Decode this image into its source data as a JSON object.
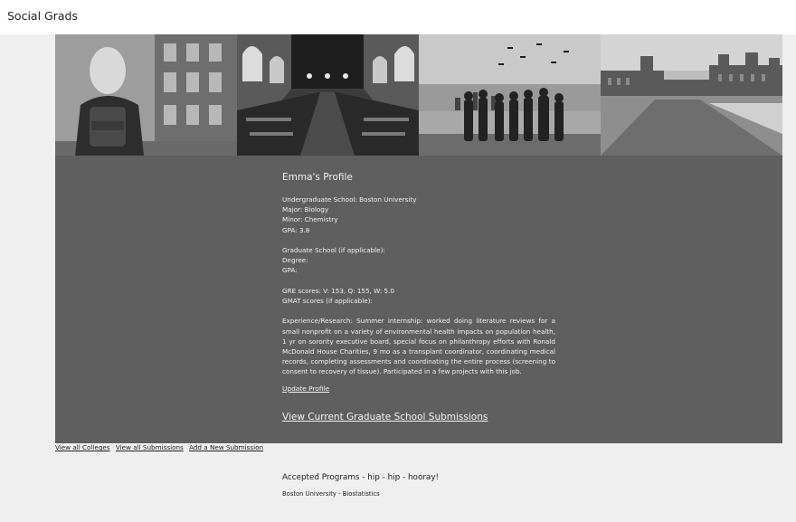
{
  "header": {
    "brand": "Social Grads"
  },
  "banner": {
    "tiles": [
      {
        "icon": "student-photo"
      },
      {
        "icon": "library-photo"
      },
      {
        "icon": "graduation-photo"
      },
      {
        "icon": "campus-photo"
      }
    ]
  },
  "profile": {
    "title": "Emma's Profile",
    "undergrad": "Undergraduate School: Boston University",
    "major": "Major: Biology",
    "minor": "Minor: Chemistry",
    "gpa": "GPA: 3.8",
    "grad_school": "Graduate School (if applicable):",
    "degree": "Degree:",
    "grad_gpa": "GPA:",
    "gre": "GRE scores: V: 153, Q: 155, W: 5.0",
    "gmat": "GMAT scores (if applicable):",
    "experience": "Experience/Research: Summer internship: worked doing literature reviews for a small nonprofit on a variety of environmental health impacts on population health, 1 yr on sorority executive board, special focus on philanthropy efforts with Ronald McDonald House Charities, 9 mo as a transplant coordinator, coordinating medical records, completing assessments and coordinating the entire process (screening to consent to recovery of tissue). Participated in a few projects with this job.",
    "update_link": "Update Profile",
    "submissions_link": "View Current Graduate School Submissions"
  },
  "subnav": {
    "colleges": "View all Colleges",
    "submissions": "View all Submissions",
    "add": "Add a New Submission"
  },
  "accepted": {
    "heading": "Accepted Programs - hip - hip - hooray!",
    "items": [
      "Boston University - Biostatistics"
    ]
  }
}
